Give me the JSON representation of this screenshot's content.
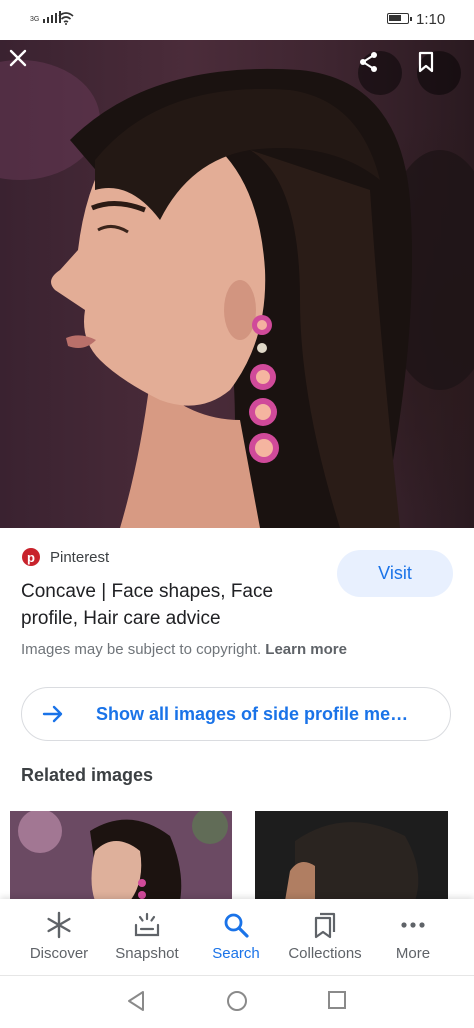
{
  "status_bar": {
    "network": "3G",
    "time": "1:10"
  },
  "viewer": {
    "close_icon": "close-icon",
    "share_icon": "share-icon",
    "bookmark_icon": "bookmark-icon"
  },
  "result": {
    "source_name": "Pinterest",
    "title": "Concave | Face shapes, Face profile, Hair care advice",
    "visit_label": "Visit",
    "copyright_text": "Images may be subject to copyright.",
    "learn_more": "Learn more",
    "show_all_label": "Show all images of side profile me…",
    "related_heading": "Related images"
  },
  "bottom_nav": {
    "items": [
      {
        "label": "Discover",
        "icon": "asterisk-icon",
        "active": false
      },
      {
        "label": "Snapshot",
        "icon": "snapshot-icon",
        "active": false
      },
      {
        "label": "Search",
        "icon": "search-icon",
        "active": true
      },
      {
        "label": "Collections",
        "icon": "collections-icon",
        "active": false
      },
      {
        "label": "More",
        "icon": "more-dots-icon",
        "active": false
      }
    ]
  },
  "colors": {
    "accent": "#1a73e8",
    "visit_bg": "#e8f0fe",
    "pinterest": "#c8232c"
  }
}
